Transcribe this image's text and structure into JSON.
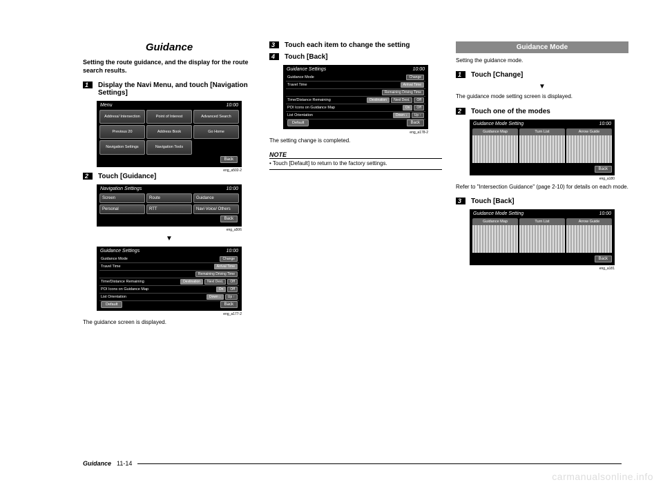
{
  "col1": {
    "title": "Guidance",
    "intro": "Setting the route guidance, and the display for the route search results.",
    "step1_num": "1",
    "step1_text": "Display the Navi Menu, and touch [Navigation Settings]",
    "screen1": {
      "title": "Menu",
      "time": "10:00",
      "items": [
        "Address/ Intersection",
        "Point of Interest",
        "Advanced Search",
        "Previous 20",
        "Address Book",
        "Go Home",
        "Navigation Settings",
        "Navigation Tools",
        ""
      ],
      "back": "Back",
      "caption": "eng_a502-2"
    },
    "step2_num": "2",
    "step2_text": "Touch [Guidance]",
    "screen2": {
      "title": "Navigation Settings",
      "time": "10:00",
      "items": [
        "Screen",
        "Route",
        "Guidance",
        "Personal",
        "RTT",
        "Navi Voice/ Others"
      ],
      "back": "Back",
      "caption": "eng_a506"
    },
    "screen3": {
      "title": "Guidance Settings",
      "time": "10:00",
      "rows": [
        {
          "label": "Guidance Mode",
          "opts": [
            "",
            "Change"
          ]
        },
        {
          "label": "Travel Time",
          "opts": [
            "Arrival Time",
            "Remaining Driving Time"
          ]
        },
        {
          "label": "Time/Distance Remaining",
          "opts": [
            "Destination",
            "Next Dest.",
            "Off"
          ]
        },
        {
          "label": "POI Icons on Guidance Map",
          "opts": [
            "On",
            "Off"
          ]
        },
        {
          "label": "List Orientation",
          "opts": [
            "Down ↓",
            "Up ↑"
          ]
        }
      ],
      "default": "Default",
      "back": "Back",
      "caption": "eng_a177-2"
    },
    "result1": "The guidance screen is displayed."
  },
  "col2": {
    "step3_num": "3",
    "step3_text": "Touch each item to change the setting",
    "step4_num": "4",
    "step4_text": "Touch [Back]",
    "screen4": {
      "title": "Guidance Settings",
      "time": "10:00",
      "rows": [
        {
          "label": "Guidance Mode",
          "opts": [
            "",
            "Change"
          ]
        },
        {
          "label": "Travel Time",
          "opts": [
            "Arrival Time",
            "Remaining Driving Time"
          ]
        },
        {
          "label": "Time/Distance Remaining",
          "opts": [
            "Destination",
            "Next Dest.",
            "Off"
          ]
        },
        {
          "label": "POI Icons on Guidance Map",
          "opts": [
            "On",
            "Off"
          ]
        },
        {
          "label": "List Orientation",
          "opts": [
            "Down ↓",
            "Up ↑"
          ]
        }
      ],
      "default": "Default",
      "back": "Back",
      "caption": "eng_a178-2"
    },
    "result2": "The setting change is completed.",
    "note_title": "NOTE",
    "note_body": "• Touch [Default] to return to the factory settings."
  },
  "col3": {
    "header": "Guidance Mode",
    "intro": "Setting the guidance mode.",
    "step1_num": "1",
    "step1_text": "Touch [Change]",
    "result1": "The guidance mode setting screen is displayed.",
    "step2_num": "2",
    "step2_text": "Touch one of the modes",
    "screen5": {
      "title": "Guidance Mode Setting",
      "time": "10:00",
      "tabs": [
        "Guidance Map",
        "Turn List",
        "Arrow Guide"
      ],
      "back": "Back",
      "caption": "eng_a180"
    },
    "refer": "Refer to \"Intersection Guidance\" (page 2-10) for details on each mode.",
    "step3_num": "3",
    "step3_text": "Touch [Back]",
    "screen6": {
      "title": "Guidance Mode Setting",
      "time": "10:00",
      "tabs": [
        "Guidance Map",
        "Turn List",
        "Arrow Guide"
      ],
      "back": "Back",
      "caption": "eng_a181"
    }
  },
  "footer": {
    "label": "Guidance",
    "page": "11-14"
  },
  "watermark": "carmanualsonline.info",
  "arrow": "▼"
}
